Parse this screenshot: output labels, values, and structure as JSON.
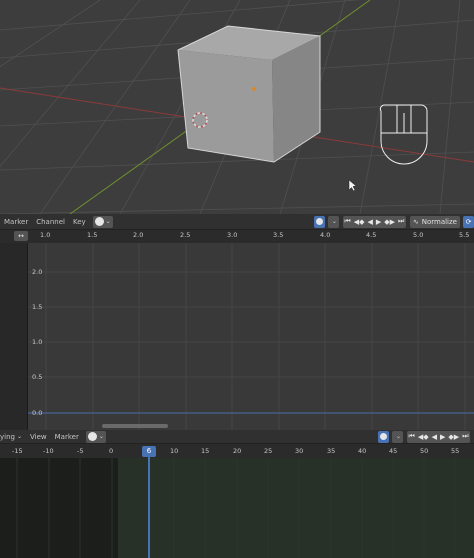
{
  "graph_editor": {
    "header": {
      "marker": "Marker",
      "channel": "Channel",
      "key": "Key",
      "normalize": "Normalize"
    },
    "frame_ticks": [
      "1.0",
      "1.5",
      "2.0",
      "2.5",
      "3.0",
      "3.5",
      "4.0",
      "4.5",
      "5.0",
      "5.5"
    ],
    "value_ticks": [
      "2.0",
      "1.5",
      "1.0",
      "0.5",
      "0.0"
    ]
  },
  "timeline": {
    "header": {
      "playing": "ying",
      "view": "View",
      "marker": "Marker"
    },
    "frame_ticks": [
      "-15",
      "-10",
      "-5",
      "0",
      "6",
      "10",
      "15",
      "20",
      "25",
      "30",
      "35",
      "40",
      "45",
      "50",
      "55"
    ],
    "current_frame": "6"
  },
  "icons": {
    "playback": [
      "jump-start-icon",
      "prev-keyframe-icon",
      "reverse-play-icon",
      "play-icon",
      "next-keyframe-icon",
      "jump-end-icon"
    ],
    "mouse": "mouse-indicator-icon",
    "cursor": "cursor-arrow-icon"
  },
  "colors": {
    "x_axis": "#8b3a3a",
    "y_axis": "#6f8f2e",
    "accent": "#4772b3",
    "cube": "#9a9a9a"
  }
}
